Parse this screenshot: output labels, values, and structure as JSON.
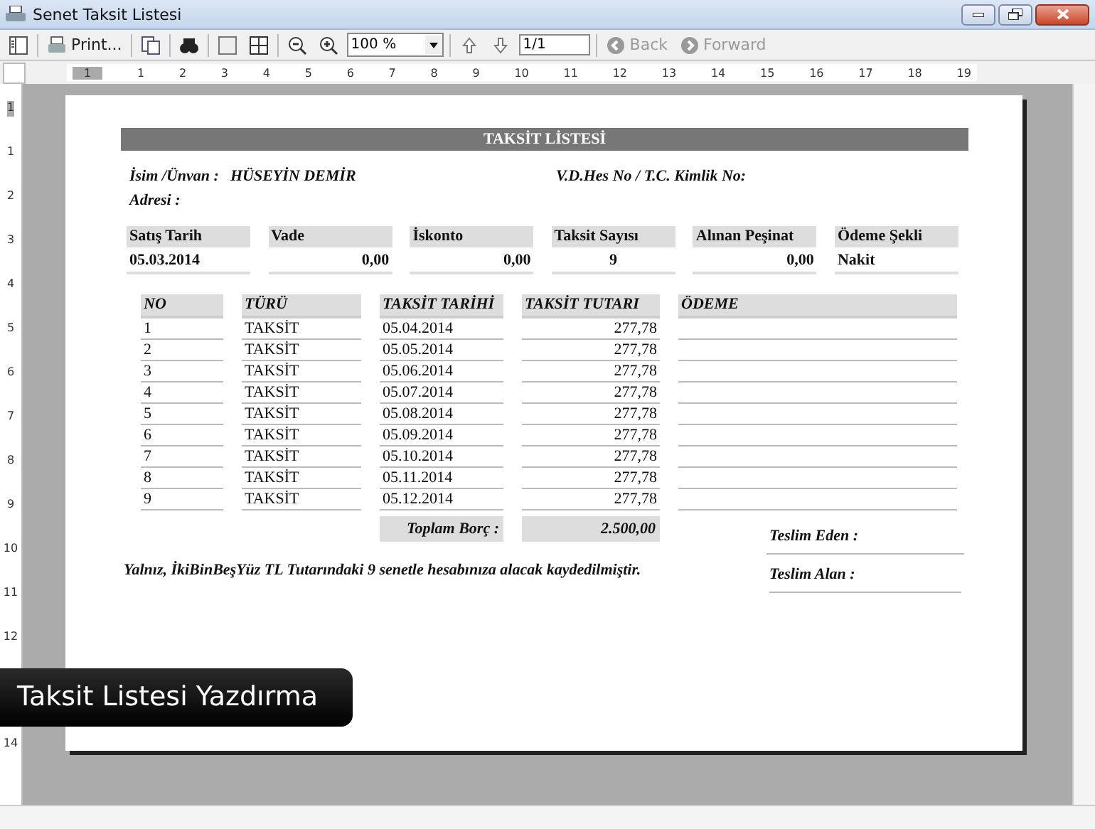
{
  "window": {
    "title": "Senet Taksit Listesi"
  },
  "toolbar": {
    "print_label": "Print...",
    "zoom": "100 %",
    "page": "1/1",
    "back": {
      "label": "Back",
      "disabled": true
    },
    "forward": {
      "label": "Forward",
      "disabled": true
    }
  },
  "rulers": {
    "horizontal": [
      "1",
      "1",
      "2",
      "3",
      "4",
      "5",
      "6",
      "7",
      "8",
      "9",
      "10",
      "11",
      "12",
      "13",
      "14",
      "15",
      "16",
      "17",
      "18",
      "19"
    ],
    "vertical": [
      "1",
      "1",
      "2",
      "3",
      "4",
      "5",
      "6",
      "7",
      "8",
      "9",
      "10",
      "11",
      "12",
      "14"
    ]
  },
  "report": {
    "title": "TAKSİT LİSTESİ",
    "name_label": "İsim /Ünvan :",
    "name": "HÜSEYİN DEMİR",
    "tax_label": "V.D.Hes No / T.C. Kimlik No:",
    "address_label": "Adresi :",
    "summary": [
      {
        "label": "Satış Tarih",
        "value": "05.03.2014",
        "kind": "text"
      },
      {
        "label": "Vade",
        "value": "0,00",
        "kind": "amount"
      },
      {
        "label": "İskonto",
        "value": "0,00",
        "kind": "amount"
      },
      {
        "label": "Taksit Sayısı",
        "value": "9",
        "kind": "count"
      },
      {
        "label": "Alınan Peşinat",
        "value": "0,00",
        "kind": "amount"
      },
      {
        "label": "Ödeme Şekli",
        "value": "Nakit",
        "kind": "text"
      }
    ],
    "table": {
      "columns": [
        "NO",
        "TÜRÜ",
        "TAKSİT TARİHİ",
        "TAKSİT TUTARI",
        "ÖDEME"
      ],
      "rows": [
        [
          "1",
          "TAKSİT",
          "05.04.2014",
          "277,78"
        ],
        [
          "2",
          "TAKSİT",
          "05.05.2014",
          "277,78"
        ],
        [
          "3",
          "TAKSİT",
          "05.06.2014",
          "277,78"
        ],
        [
          "4",
          "TAKSİT",
          "05.07.2014",
          "277,78"
        ],
        [
          "5",
          "TAKSİT",
          "05.08.2014",
          "277,78"
        ],
        [
          "6",
          "TAKSİT",
          "05.09.2014",
          "277,78"
        ],
        [
          "7",
          "TAKSİT",
          "05.10.2014",
          "277,78"
        ],
        [
          "8",
          "TAKSİT",
          "05.11.2014",
          "277,78"
        ],
        [
          "9",
          "TAKSİT",
          "05.12.2014",
          "277,78"
        ]
      ]
    },
    "total_label": "Toplam Borç :",
    "total": "2.500,00",
    "note": "Yalnız, İkiBinBeşYüz TL Tutarındaki 9 senetle hesabınıza alacak kaydedilmiştir.",
    "delivered_by": "Teslim Eden :",
    "received_by": "Teslim Alan :"
  },
  "caption": "Taksit Listesi Yazdırma"
}
